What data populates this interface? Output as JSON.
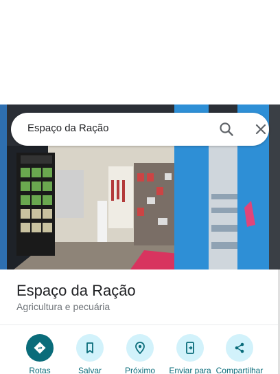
{
  "search": {
    "query": "Espaço da Ração"
  },
  "place": {
    "title": "Espaço da Ração",
    "category": "Agricultura e pecuária"
  },
  "actions": [
    {
      "label": "Rotas",
      "icon": "directions-icon"
    },
    {
      "label": "Salvar",
      "icon": "bookmark-icon"
    },
    {
      "label": "Próximo",
      "icon": "nearby-icon"
    },
    {
      "label": "Enviar para",
      "icon": "send-to-phone-icon"
    },
    {
      "label": "Compartilhar",
      "icon": "share-icon"
    }
  ],
  "colors": {
    "accent": "#0a6c7a",
    "action_bg": "#d2f2fb",
    "storefront_blue": "#2e8fd6"
  }
}
